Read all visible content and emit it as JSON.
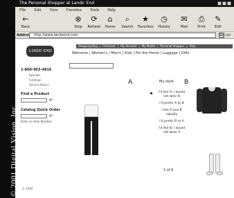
{
  "watermark": {
    "text": "2001 Digital Vision, Inc.",
    "symbol": "©"
  },
  "browser": {
    "title": "The Personal Shopper at Lands' End",
    "menu": [
      "File",
      "Edit",
      "View",
      "Favorites",
      "Tools",
      "Help"
    ],
    "toolbar": [
      {
        "label": "Back",
        "icon": "back-arrow-icon",
        "glyph": "←"
      },
      {
        "label": "Stop",
        "icon": "stop-icon",
        "glyph": "⊗"
      },
      {
        "label": "Refresh",
        "icon": "refresh-icon",
        "glyph": "⟳"
      },
      {
        "label": "Home",
        "icon": "home-icon",
        "glyph": "⌂"
      },
      {
        "label": "Search",
        "icon": "search-icon",
        "glyph": "⌕"
      },
      {
        "label": "Favorites",
        "icon": "favorites-icon",
        "glyph": "★"
      },
      {
        "label": "History",
        "icon": "history-icon",
        "glyph": "◷"
      },
      {
        "label": "Mail",
        "icon": "mail-icon",
        "glyph": "✉"
      },
      {
        "label": "Print",
        "icon": "print-icon",
        "glyph": "⎙"
      },
      {
        "label": "Edit",
        "icon": "edit-icon",
        "glyph": "✎"
      }
    ],
    "address_label": "Address",
    "address_value": "http://www.landsend.com",
    "go_label": "Go",
    "links_label": "Lin"
  },
  "page": {
    "logo": "LANDS' END",
    "top_nav": [
      "Shopping Bag",
      "Checkout",
      "My Account",
      "My Model",
      "Personal Shopper",
      "Help"
    ],
    "category_nav": [
      "Welcome",
      "Women's",
      "Men's",
      "Kids",
      "For the Home",
      "Luggage",
      "Gifts"
    ],
    "phone": "1-800-963-4816",
    "left_links": [
      "Specials",
      "Catalogs",
      "Service Basics"
    ],
    "find_product": "Find a Product",
    "catalog_quick_order": "Catalog Quick Order",
    "go": "go",
    "item_number_label": "Enter an Item Number",
    "label_a": "A",
    "label_b": "B",
    "my_style": "My style",
    "questions": [
      "I'd like A; I would not wear B",
      "I'd prefer A to B",
      "I like A and B equally",
      "I'd prefer B to A",
      "I'd like B; I would not wear A"
    ],
    "pager": "1 of 6",
    "footer": "© 2000"
  }
}
